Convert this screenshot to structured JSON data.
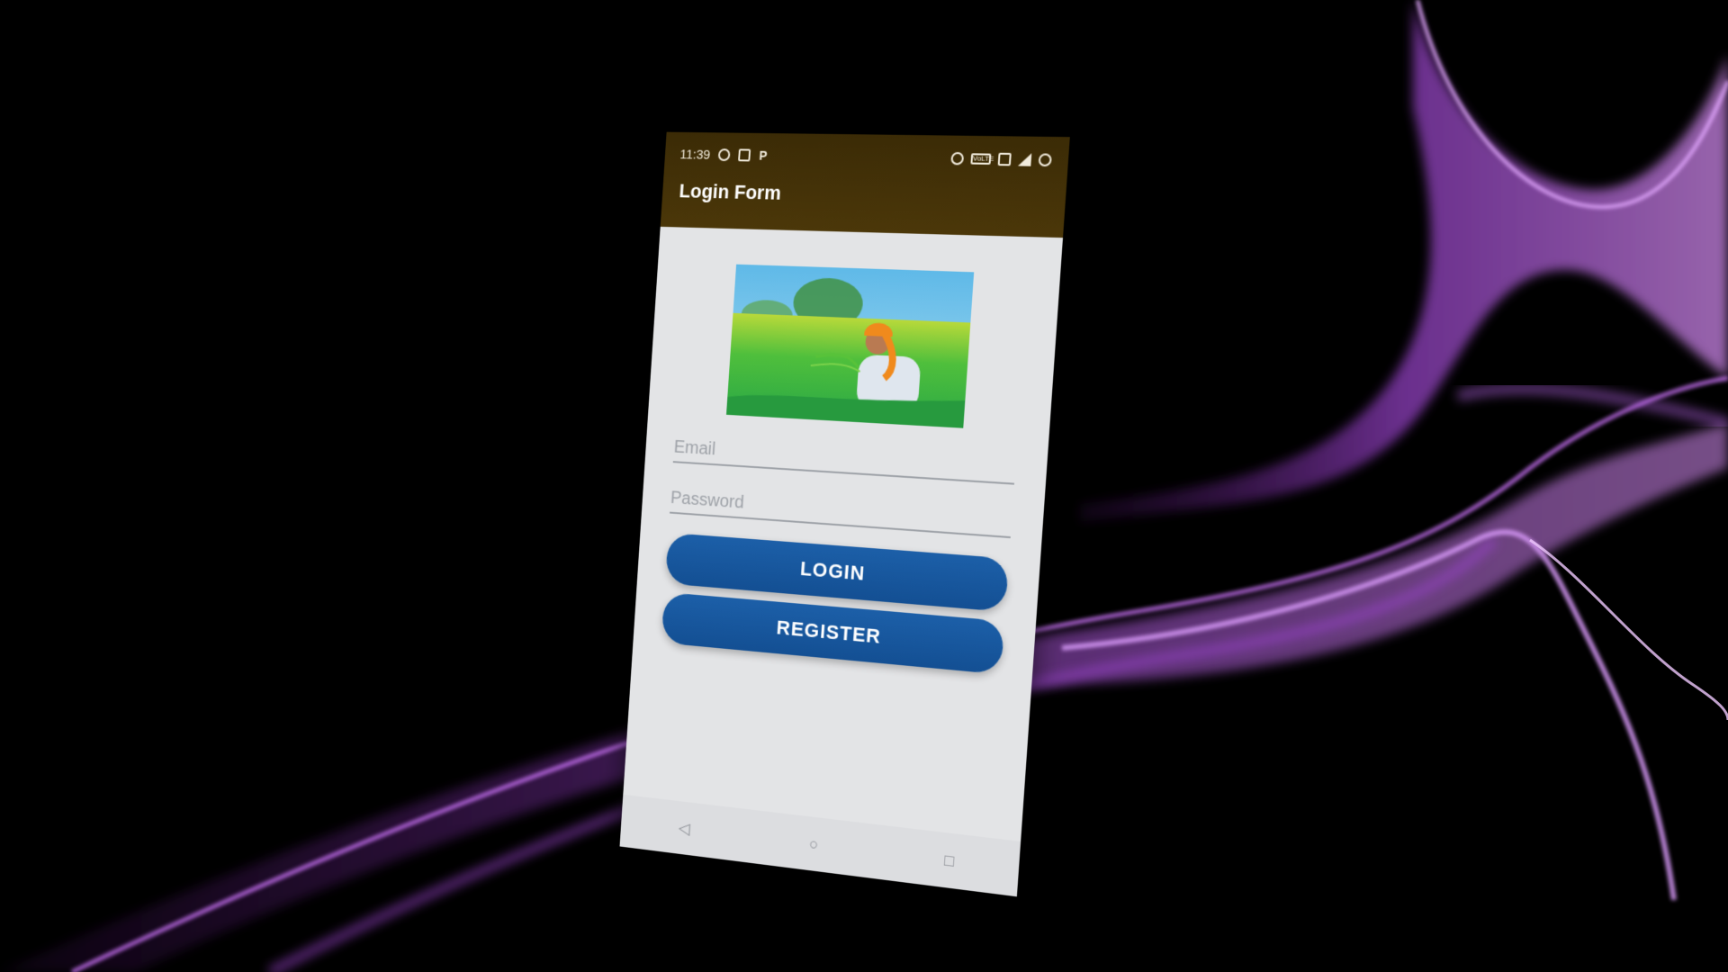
{
  "status_bar": {
    "time": "11:39",
    "left_icons": [
      "whatsapp-icon",
      "image-notification-icon",
      "p-notification-icon"
    ],
    "right_icons": [
      "hotspot-icon",
      "volte-icon",
      "vibrate-icon",
      "signal-icon",
      "eye-comfort-icon"
    ],
    "volte_label": "VoLTE"
  },
  "app_bar": {
    "title": "Login Form",
    "background_color": "#3b2b06"
  },
  "form": {
    "hero_image_icon": "farmer-in-field-photo",
    "email_placeholder": "Email",
    "email_value": "",
    "password_placeholder": "Password",
    "password_value": "",
    "login_label": "LOGIN",
    "register_label": "REGISTER",
    "button_color": "#1a5ba3"
  },
  "nav_bar": {
    "icons": [
      "back-icon",
      "home-icon",
      "recents-icon"
    ]
  },
  "background": {
    "accent_color": "#b04fe0"
  }
}
